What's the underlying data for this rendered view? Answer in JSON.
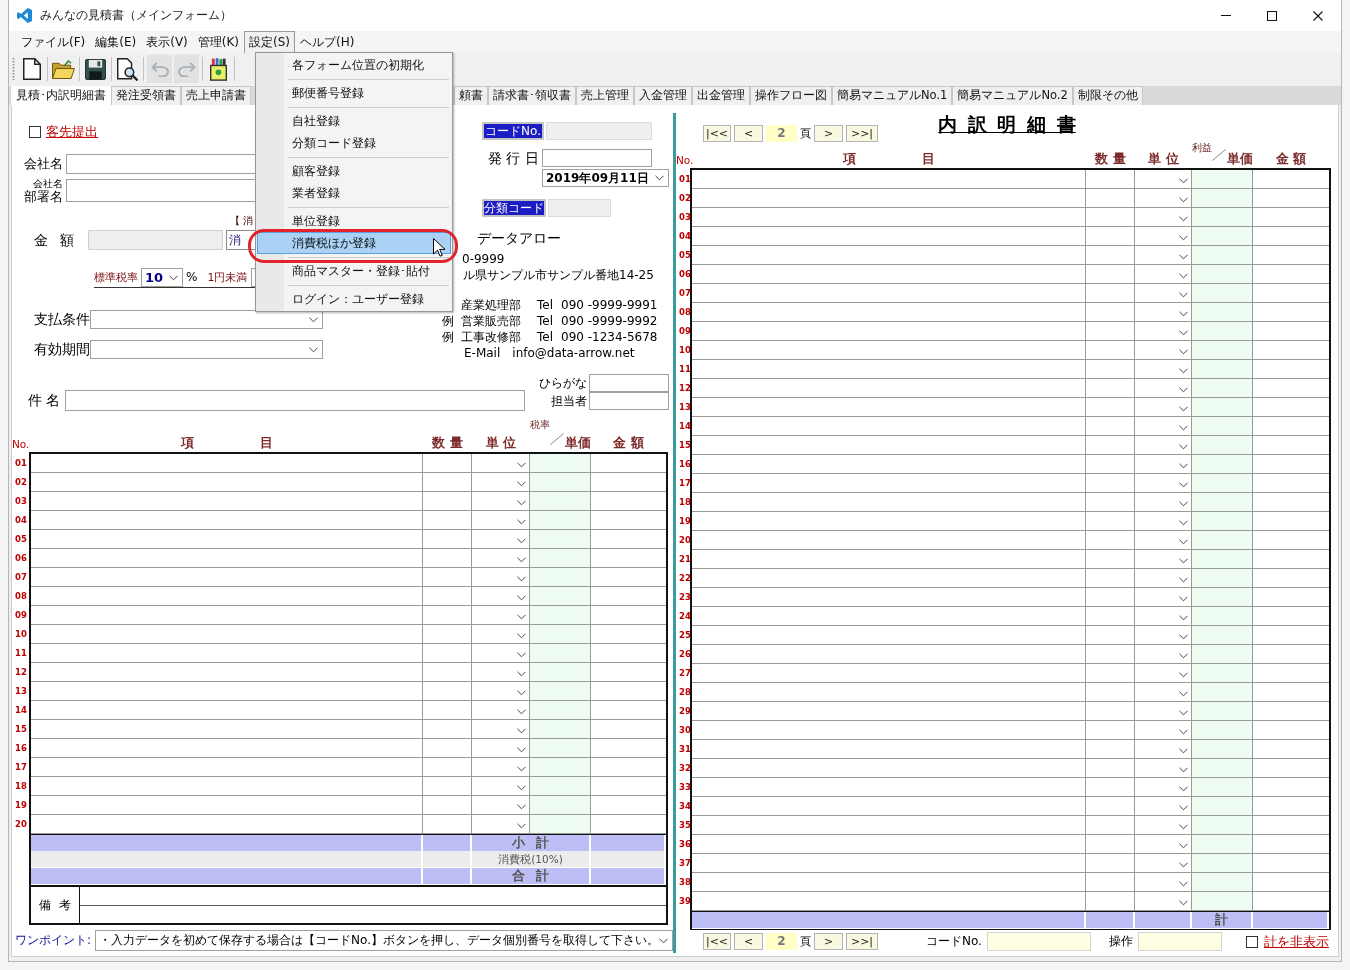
{
  "window": {
    "title": "みんなの見積書（メインフォーム）"
  },
  "menu_bar": [
    {
      "label": "ファイル(F)",
      "selected": false
    },
    {
      "label": "編集(E)",
      "selected": false
    },
    {
      "label": "表示(V)",
      "selected": false
    },
    {
      "label": "管理(K)",
      "selected": false
    },
    {
      "label": "設定(S)",
      "selected": true
    },
    {
      "label": "ヘルプ(H)",
      "selected": false
    }
  ],
  "toolbar": {
    "groups": [
      {
        "buttons": [
          {
            "kind": "new",
            "disabled": false
          }
        ]
      },
      {
        "buttons": [
          {
            "kind": "open",
            "disabled": false
          }
        ]
      },
      {
        "buttons": [
          {
            "kind": "save",
            "disabled": false
          }
        ]
      },
      {
        "buttons": [
          {
            "kind": "preview",
            "disabled": false
          }
        ]
      },
      {
        "buttons": [
          {
            "kind": "undo",
            "disabled": true
          },
          {
            "kind": "redo",
            "disabled": true
          }
        ]
      },
      {
        "buttons": [
          {
            "kind": "tools",
            "disabled": false
          }
        ]
      }
    ]
  },
  "tabs": [
    {
      "label": "見積･内訳明細書",
      "selected": true
    },
    {
      "label": "発注受領書",
      "selected": false
    },
    {
      "label": "売上申請書",
      "selected": false
    },
    {
      "label": "頼書",
      "selected": false
    },
    {
      "label": "請求書･領収書",
      "selected": false
    },
    {
      "label": "売上管理",
      "selected": false
    },
    {
      "label": "入金管理",
      "selected": false
    },
    {
      "label": "出金管理",
      "selected": false
    },
    {
      "label": "操作フロー図",
      "selected": false
    },
    {
      "label": "簡易マニュアルNo.1",
      "selected": false
    },
    {
      "label": "簡易マニュアルNo.2",
      "selected": false
    },
    {
      "label": "制限その他",
      "selected": false
    }
  ],
  "settings_menu": {
    "groups": [
      {
        "items": [
          {
            "label": "各フォーム位置の初期化",
            "selected": false
          }
        ]
      },
      {
        "items": [
          {
            "label": "郵便番号登録",
            "selected": false
          }
        ]
      },
      {
        "items": [
          {
            "label": "自社登録",
            "selected": false
          },
          {
            "label": "分類コード登録",
            "selected": false
          }
        ]
      },
      {
        "items": [
          {
            "label": "顧客登録",
            "selected": false
          },
          {
            "label": "業者登録",
            "selected": false
          }
        ]
      },
      {
        "items": [
          {
            "label": "単位登録",
            "selected": false
          },
          {
            "label": "消費税ほか登録",
            "selected": true
          }
        ]
      },
      {
        "items": [
          {
            "label": "商品マスター・登録･貼付",
            "selected": false
          }
        ]
      },
      {
        "items": [
          {
            "label": "ログイン：ユーザー登録",
            "selected": false
          }
        ]
      }
    ]
  },
  "estimate": {
    "submit_to_client": {
      "label": "客先提出",
      "checked": false
    },
    "company_name": {
      "label": "会社名"
    },
    "department": {
      "label_top": "会社名",
      "label": "部署名"
    },
    "tax_note": "【 消",
    "amount": {
      "label": "金 額",
      "tax_mode": "消"
    },
    "tax_rate": {
      "label": "標準税率",
      "value": "10",
      "unit": "%"
    },
    "rounding": {
      "label": "1円未満"
    },
    "payment_terms": {
      "label": "支払条件"
    },
    "validity": {
      "label": "有効期間"
    },
    "code_no": {
      "button": "コードNo."
    },
    "issue_date": {
      "label": "発 行 日",
      "date": "2019年09月11日"
    },
    "category_code": {
      "button": "分類コード"
    },
    "issuer": {
      "name": "データアロー",
      "postal_code": "0-9999",
      "address": "ル県サンプル市サンプル番地14-25",
      "departments": [
        {
          "name": "産業処理部",
          "tel_label": "Tel",
          "tel": "090 -9999-9991"
        },
        {
          "prefix": "例",
          "name": "営業販売部",
          "tel_label": "Tel",
          "tel": "090 -9999-9992"
        },
        {
          "prefix": "例",
          "name": "工事改修部",
          "tel_label": "Tel",
          "tel": "090 -1234-5678"
        }
      ],
      "email_label": "E-Mail",
      "email": "info@data-arrow.net"
    },
    "subject": {
      "label": "件 名"
    },
    "furigana": {
      "label": "ひらがな"
    },
    "person_in_charge": {
      "label": "担当者"
    },
    "table": {
      "columns": [
        {
          "label": "No."
        },
        {
          "label": "項 目"
        },
        {
          "label": "数 量"
        },
        {
          "label": "単 位"
        },
        {
          "label": "単価",
          "corner_label": "税率"
        },
        {
          "label": "金 額"
        }
      ],
      "rows": [
        {
          "no": "01"
        },
        {
          "no": "02"
        },
        {
          "no": "03"
        },
        {
          "no": "04"
        },
        {
          "no": "05"
        },
        {
          "no": "06"
        },
        {
          "no": "07"
        },
        {
          "no": "08"
        },
        {
          "no": "09"
        },
        {
          "no": "10"
        },
        {
          "no": "11"
        },
        {
          "no": "12"
        },
        {
          "no": "13"
        },
        {
          "no": "14"
        },
        {
          "no": "15"
        },
        {
          "no": "16"
        },
        {
          "no": "17"
        },
        {
          "no": "18"
        },
        {
          "no": "19"
        },
        {
          "no": "20"
        }
      ],
      "summary": [
        {
          "kind": "subtotal",
          "label": "小 計"
        },
        {
          "kind": "tax",
          "label": "消費税(10%)"
        },
        {
          "kind": "total",
          "label": "合 計"
        }
      ]
    },
    "remarks": {
      "label": "備 考"
    },
    "tip": {
      "label": "ワンポイント:",
      "value": "・入力データを初めて保存する場合は【コードNo.】ボタンを押し、データ個別番号を取得して下さい。"
    }
  },
  "detail": {
    "title": "内 訳 明 細 書",
    "pager_top": {
      "first": "|<<",
      "prev": "<",
      "page": "2",
      "page_unit": "頁",
      "next": ">",
      "last": ">>|"
    },
    "table": {
      "columns": [
        {
          "label": "No."
        },
        {
          "label": "項 目"
        },
        {
          "label": "数 量"
        },
        {
          "label": "単 位"
        },
        {
          "label": "単価",
          "corner_label": "利益"
        },
        {
          "label": "金 額"
        }
      ],
      "rows": [
        {
          "no": "01"
        },
        {
          "no": "02"
        },
        {
          "no": "03"
        },
        {
          "no": "04"
        },
        {
          "no": "05"
        },
        {
          "no": "06"
        },
        {
          "no": "07"
        },
        {
          "no": "08"
        },
        {
          "no": "09"
        },
        {
          "no": "10"
        },
        {
          "no": "11"
        },
        {
          "no": "12"
        },
        {
          "no": "13"
        },
        {
          "no": "14"
        },
        {
          "no": "15"
        },
        {
          "no": "16"
        },
        {
          "no": "17"
        },
        {
          "no": "18"
        },
        {
          "no": "19"
        },
        {
          "no": "20"
        },
        {
          "no": "21"
        },
        {
          "no": "22"
        },
        {
          "no": "23"
        },
        {
          "no": "24"
        },
        {
          "no": "25"
        },
        {
          "no": "26"
        },
        {
          "no": "27"
        },
        {
          "no": "28"
        },
        {
          "no": "29"
        },
        {
          "no": "30"
        },
        {
          "no": "31"
        },
        {
          "no": "32"
        },
        {
          "no": "33"
        },
        {
          "no": "34"
        },
        {
          "no": "35"
        },
        {
          "no": "36"
        },
        {
          "no": "37"
        },
        {
          "no": "38"
        },
        {
          "no": "39"
        }
      ],
      "total_label": "計"
    },
    "pager_bottom": {
      "first": "|<<",
      "prev": "<",
      "page": "2",
      "page_unit": "頁",
      "next": ">",
      "last": ">>|"
    },
    "code_no_label": "コードNo.",
    "operation_label": "操作",
    "hide_totals": {
      "label": "計を非表示",
      "checked": false
    }
  }
}
